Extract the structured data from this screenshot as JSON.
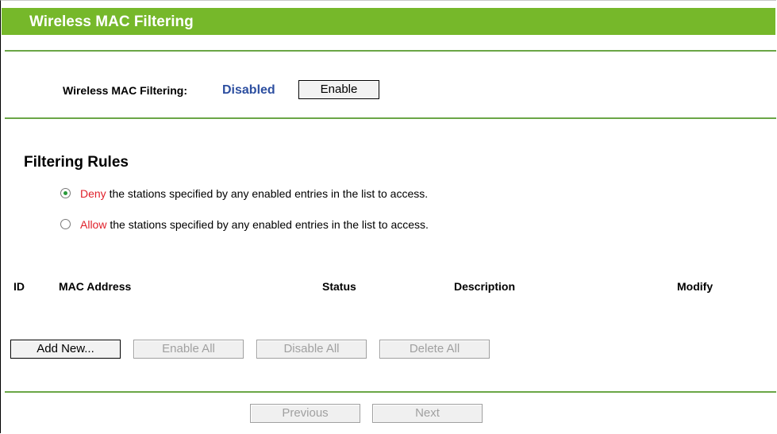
{
  "header": {
    "title": "Wireless MAC Filtering"
  },
  "filtering": {
    "label": "Wireless MAC Filtering:",
    "status": "Disabled",
    "enable_button": "Enable"
  },
  "rules": {
    "title": "Filtering Rules",
    "options": [
      {
        "keyword": "Deny",
        "text": " the stations specified by any enabled entries in the list to access.",
        "selected": true
      },
      {
        "keyword": "Allow",
        "text": " the stations specified by any enabled entries in the list to access.",
        "selected": false
      }
    ]
  },
  "table": {
    "columns": [
      "ID",
      "MAC Address",
      "Status",
      "Description",
      "Modify"
    ]
  },
  "actions": {
    "add_new": "Add New...",
    "enable_all": "Enable All",
    "disable_all": "Disable All",
    "delete_all": "Delete All"
  },
  "pager": {
    "previous": "Previous",
    "next": "Next"
  },
  "colors": {
    "header_green": "#76b82a",
    "status_blue": "#2d4fa0",
    "keyword_red": "#e0202a"
  }
}
